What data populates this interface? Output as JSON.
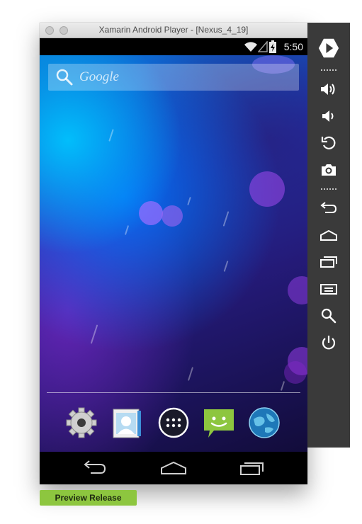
{
  "window": {
    "title": "Xamarin Android Player - [Nexus_4_19]"
  },
  "status_bar": {
    "time": "5:50",
    "icons": [
      "wifi-icon",
      "signal-icon",
      "battery-charging-icon"
    ]
  },
  "search_bar": {
    "text": "Google",
    "icon": "search-icon"
  },
  "dock": {
    "apps": [
      {
        "icon": "settings-gear-icon"
      },
      {
        "icon": "contacts-icon"
      },
      {
        "icon": "app-drawer-icon"
      },
      {
        "icon": "messaging-icon"
      },
      {
        "icon": "browser-globe-icon"
      }
    ]
  },
  "nav_bar": {
    "buttons": [
      "back-icon",
      "home-icon",
      "recent-apps-icon"
    ]
  },
  "toolbar": {
    "buttons": [
      "play-icon",
      "volume-up-icon",
      "volume-down-icon",
      "rotate-icon",
      "screenshot-camera-icon",
      "back-icon",
      "home-icon",
      "recent-apps-icon",
      "menu-icon",
      "search-icon",
      "power-icon"
    ]
  },
  "footer": {
    "badge": "Preview Release"
  },
  "colors": {
    "accent_green": "#8dc63f",
    "sidebar_bg": "#3a3a3a"
  }
}
